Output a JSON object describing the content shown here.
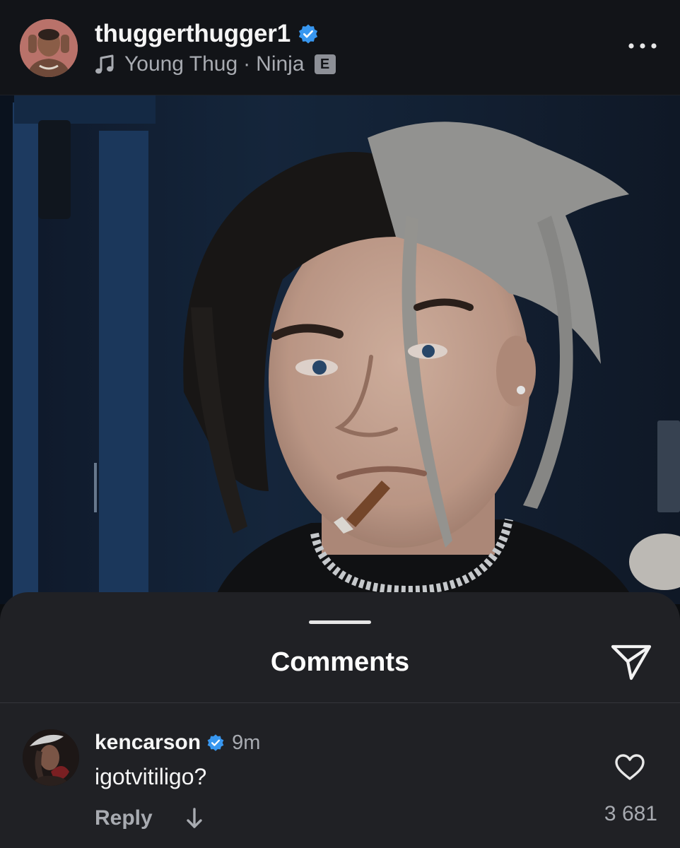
{
  "post": {
    "username": "thuggerthugger1",
    "verified": true,
    "audio": {
      "artist": "Young Thug",
      "separator": "·",
      "track": "Ninja",
      "explicit_badge": "E"
    },
    "icons": {
      "verified": "verified-badge-icon",
      "music": "music-note-icon",
      "more": "more-options-icon"
    }
  },
  "comments_sheet": {
    "title": "Comments",
    "icons": {
      "share": "paper-plane-share-icon",
      "like": "heart-icon",
      "expand": "down-arrow-icon"
    },
    "comments": [
      {
        "username": "kencarson",
        "verified": true,
        "time": "9m",
        "text": "igotvitiligo?",
        "reply_label": "Reply",
        "like_count": "3 681"
      }
    ]
  },
  "colors": {
    "background": "#121418",
    "sheet": "#202125",
    "verified_blue": "#3897f0",
    "text_primary": "#f5f5f5",
    "text_secondary": "#a8abb1"
  }
}
